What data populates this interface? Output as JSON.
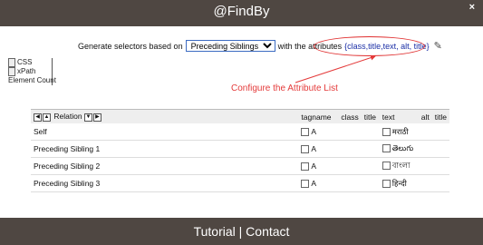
{
  "header": {
    "title": "@FindBy",
    "close": "×"
  },
  "generator": {
    "prefix": "Generate selectors based on",
    "selected_option": "Preceding Siblings",
    "middle": "with the attributes",
    "attributes": "{class,title,text, alt, title}"
  },
  "annotation": {
    "text": "Configure the Attribute List"
  },
  "side_menu": {
    "css": "CSS",
    "xpath": "xPath",
    "element_count": "Element Count"
  },
  "table": {
    "relation_header": "Relation",
    "headers": [
      "tagname",
      "class",
      "title",
      "text",
      "alt",
      "title"
    ],
    "rows": [
      {
        "relation": "Self",
        "tag": "A",
        "text": "मराठी"
      },
      {
        "relation": "Preceding Sibling 1",
        "tag": "A",
        "text": "తెలుగు"
      },
      {
        "relation": "Preceding Sibling 2",
        "tag": "A",
        "text": "বাংলা"
      },
      {
        "relation": "Preceding Sibling 3",
        "tag": "A",
        "text": "हिन्दी"
      }
    ]
  },
  "footer": {
    "tutorial": "Tutorial",
    "separator": " | ",
    "contact": "Contact"
  }
}
